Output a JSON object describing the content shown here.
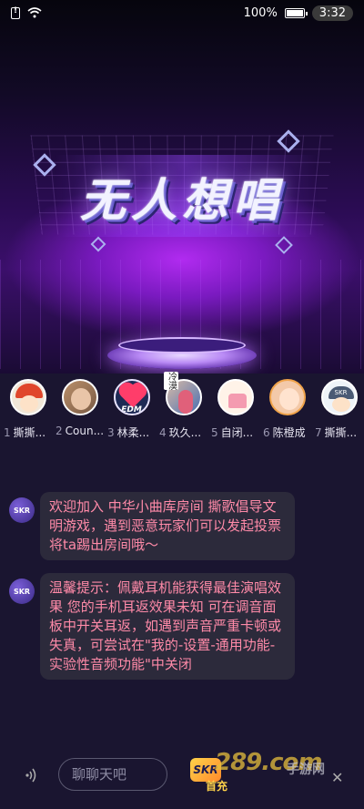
{
  "status_bar": {
    "battery": "100%",
    "time": "3:32"
  },
  "room": {
    "title": "无人想唱"
  },
  "seats": [
    {
      "num": "1",
      "name": "撕撕..."
    },
    {
      "num": "2",
      "name": "Coun..."
    },
    {
      "num": "3",
      "name": "林柔..."
    },
    {
      "num": "4",
      "name": "玖久..."
    },
    {
      "num": "5",
      "name": "自闭..."
    },
    {
      "num": "6",
      "name": "陈橙成"
    },
    {
      "num": "7",
      "name": "撕撕..."
    }
  ],
  "seat_tags": {
    "edm": "EDM",
    "seat4": "冷漠",
    "seat7_hat": "SKR"
  },
  "messages": [
    {
      "avatar": "SKR",
      "text": "欢迎加入 中华小曲库房间 撕歌倡导文明游戏，遇到恶意玩家们可以发起投票将ta踢出房间哦～"
    },
    {
      "avatar": "SKR",
      "text": "温馨提示：佩戴耳机能获得最佳演唱效果 您的手机耳返效果未知 可在调音面板中开关耳返，如遇到声音严重卡顿或失真，可尝试在\"我的-设置-通用功能-实验性音频功能\"中关闭"
    }
  ],
  "bottom": {
    "chat_placeholder": "聊聊天吧",
    "skr_label": "SKR",
    "first_charge": "首充",
    "watermark": "289.com",
    "watermark_sub": "手游网"
  },
  "icons": {
    "voice": "voice-wave-icon",
    "close": "close-icon"
  },
  "colors": {
    "message_text": "#ff8aa8",
    "bubble_bg": "#2c2a3b",
    "page_bg": "#1a1530"
  }
}
